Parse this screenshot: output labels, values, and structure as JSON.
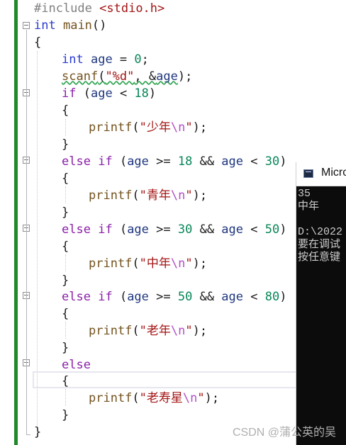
{
  "editor": {
    "tokens": {
      "include": "#include",
      "header": "<stdio.h>",
      "int": "int",
      "main": "main",
      "parens": "()",
      "open_brace": "{",
      "close_brace": "}",
      "age": "age",
      "assign": " = ",
      "zero": "0",
      "semicolon": ";",
      "scanf": "scanf",
      "fmt": "\"%d\"",
      "comma_amp": ", &",
      "close_paren_semi": ");",
      "if": "if",
      "else": "else",
      "lt": " < ",
      "ge": " >= ",
      "and": " && ",
      "n18": "18",
      "n30": "30",
      "n50": "50",
      "n80": "80",
      "printf": "printf",
      "lp": "(",
      "rp": ")",
      "quote": "\"",
      "newline_esc": "\\n",
      "s1": "少年",
      "s2": "青年",
      "s3": "中年",
      "s4": "老年",
      "s5": "老寿星"
    }
  },
  "console": {
    "title": "Micro",
    "lines": [
      "35",
      "中年",
      "",
      "D:\\2022",
      "要在调试",
      "按任意键"
    ]
  },
  "watermark": "CSDN @蒲公英的吴"
}
